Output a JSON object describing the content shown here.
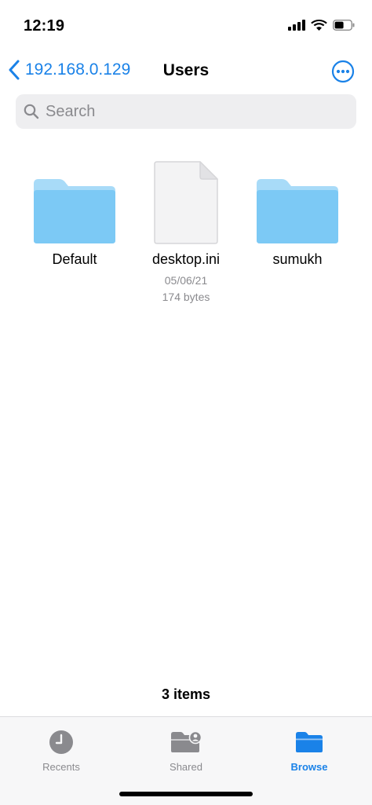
{
  "status_bar": {
    "time": "12:19"
  },
  "nav": {
    "back_label": "192.168.0.129",
    "title": "Users"
  },
  "search": {
    "placeholder": "Search",
    "value": ""
  },
  "items": [
    {
      "name": "Default",
      "kind": "folder"
    },
    {
      "name": "desktop.ini",
      "kind": "file",
      "date": "05/06/21",
      "size": "174 bytes"
    },
    {
      "name": "sumukh",
      "kind": "folder"
    }
  ],
  "footer": {
    "count": "3 items"
  },
  "tabs": [
    {
      "label": "Recents",
      "icon": "clock-icon",
      "active": false
    },
    {
      "label": "Shared",
      "icon": "shared-folder-icon",
      "active": false
    },
    {
      "label": "Browse",
      "icon": "folder-icon",
      "active": true
    }
  ],
  "colors": {
    "accent": "#1a82e8",
    "folder": "#7cc9f5",
    "folder_tab": "#a8dbf8",
    "inactive": "#8a8a8e"
  }
}
